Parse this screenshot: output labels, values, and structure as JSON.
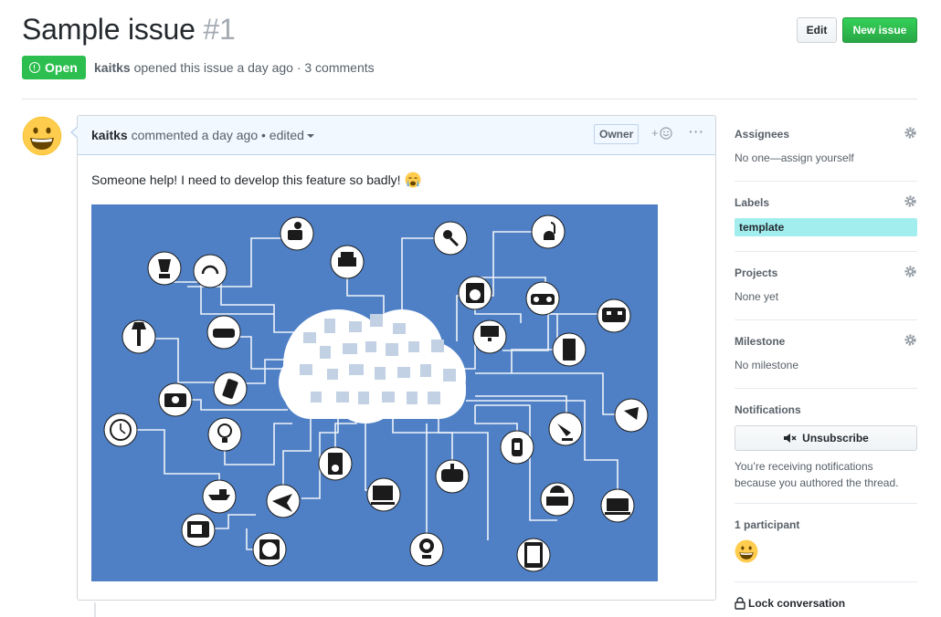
{
  "issue": {
    "title": "Sample issue",
    "number": "#1",
    "state": "Open",
    "author": "kaitks",
    "meta_text": "opened this issue a day ago · 3 comments"
  },
  "header_buttons": {
    "edit_label": "Edit",
    "new_issue_label": "New issue"
  },
  "comment": {
    "author": "kaitks",
    "action": "commented a day ago",
    "edited": "• edited",
    "owner_badge": "Owner",
    "reaction_plus": "+",
    "body": "Someone help! I need to develop this feature so badly!",
    "emoji": "crying-face-icon"
  },
  "sidebar": {
    "assignees": {
      "heading": "Assignees",
      "value": "No one—assign yourself"
    },
    "labels": {
      "heading": "Labels",
      "items": [
        {
          "name": "template",
          "color": "#a2eeef"
        }
      ]
    },
    "projects": {
      "heading": "Projects",
      "value": "None yet"
    },
    "milestone": {
      "heading": "Milestone",
      "value": "No milestone"
    },
    "notifications": {
      "heading": "Notifications",
      "button_label": "Unsubscribe",
      "description": "You’re receiving notifications because you authored the thread."
    },
    "participants": {
      "heading": "1 participant"
    },
    "lock_label": "Lock conversation"
  },
  "colors": {
    "open_green": "#2cbe4e",
    "new_issue_green": "#28a745",
    "comment_header": "#f1f8ff",
    "illustration_bg": "#4f80c5"
  }
}
